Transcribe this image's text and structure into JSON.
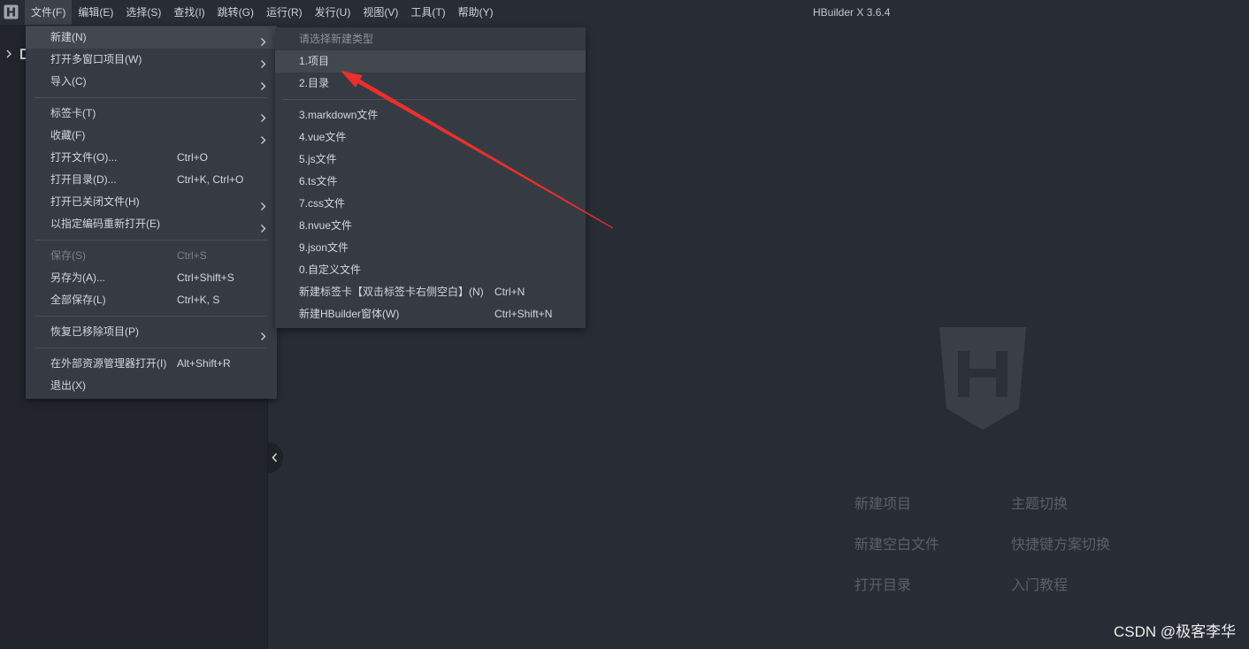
{
  "window": {
    "title": "HBuilder X 3.6.4"
  },
  "colors": {
    "editor_bg": "#282c34",
    "sidebar_bg": "#21252b",
    "menu_bg": "#363b43",
    "menu_highlight": "#43484f",
    "menu_text": "#d3d6db",
    "menu_disabled_text": "#7b8087",
    "welcome_link": "#5b6068",
    "logo_shield": "#3a3f47",
    "annotation_red": "#e8302c"
  },
  "icons": {
    "app": "hbuilder-app-icon",
    "submenu_indicator": "chevron-right-icon",
    "tree_toggle": "chevron-right-icon",
    "sidebar_toggle": "chevron-left-icon",
    "welcome_logo": "hbuilder-shield-logo-icon"
  },
  "menubar": {
    "items": [
      {
        "label": "文件(F)",
        "open": true
      },
      {
        "label": "编辑(E)"
      },
      {
        "label": "选择(S)"
      },
      {
        "label": "查找(I)"
      },
      {
        "label": "跳转(G)"
      },
      {
        "label": "运行(R)"
      },
      {
        "label": "发行(U)"
      },
      {
        "label": "视图(V)"
      },
      {
        "label": "工具(T)"
      },
      {
        "label": "帮助(Y)"
      }
    ]
  },
  "file_menu": {
    "groups": [
      [
        {
          "label": "新建(N)",
          "submenu": true,
          "highlighted": true
        },
        {
          "label": "打开多窗口项目(W)",
          "submenu": true
        },
        {
          "label": "导入(C)",
          "submenu": true
        }
      ],
      [
        {
          "label": "标签卡(T)",
          "submenu": true
        },
        {
          "label": "收藏(F)",
          "submenu": true
        },
        {
          "label": "打开文件(O)...",
          "shortcut": "Ctrl+O"
        },
        {
          "label": "打开目录(D)...",
          "shortcut": "Ctrl+K, Ctrl+O"
        },
        {
          "label": "打开已关闭文件(H)",
          "submenu": true
        },
        {
          "label": "以指定编码重新打开(E)",
          "submenu": true
        }
      ],
      [
        {
          "label": "保存(S)",
          "shortcut": "Ctrl+S",
          "disabled": true
        },
        {
          "label": "另存为(A)...",
          "shortcut": "Ctrl+Shift+S"
        },
        {
          "label": "全部保存(L)",
          "shortcut": "Ctrl+K, S"
        }
      ],
      [
        {
          "label": "恢复已移除项目(P)",
          "submenu": true
        }
      ],
      [
        {
          "label": "在外部资源管理器打开(I)",
          "shortcut": "Alt+Shift+R"
        },
        {
          "label": "退出(X)"
        }
      ]
    ]
  },
  "new_submenu": {
    "header": "请选择新建类型",
    "groups": [
      [
        {
          "label": "1.项目",
          "highlighted": true
        },
        {
          "label": "2.目录"
        }
      ],
      [
        {
          "label": "3.markdown文件"
        },
        {
          "label": "4.vue文件"
        },
        {
          "label": "5.js文件"
        },
        {
          "label": "6.ts文件"
        },
        {
          "label": "7.css文件"
        },
        {
          "label": "8.nvue文件"
        },
        {
          "label": "9.json文件"
        },
        {
          "label": "0.自定义文件"
        },
        {
          "label": "新建标签卡【双击标签卡右侧空白】(N)",
          "shortcut": "Ctrl+N"
        },
        {
          "label": "新建HBuilder窗体(W)",
          "shortcut": "Ctrl+Shift+N"
        }
      ]
    ]
  },
  "welcome": {
    "links": [
      "新建项目",
      "主题切换",
      "新建空白文件",
      "快捷键方案切换",
      "打开目录",
      "入门教程"
    ]
  },
  "watermark": {
    "text": "CSDN @极客李华"
  }
}
